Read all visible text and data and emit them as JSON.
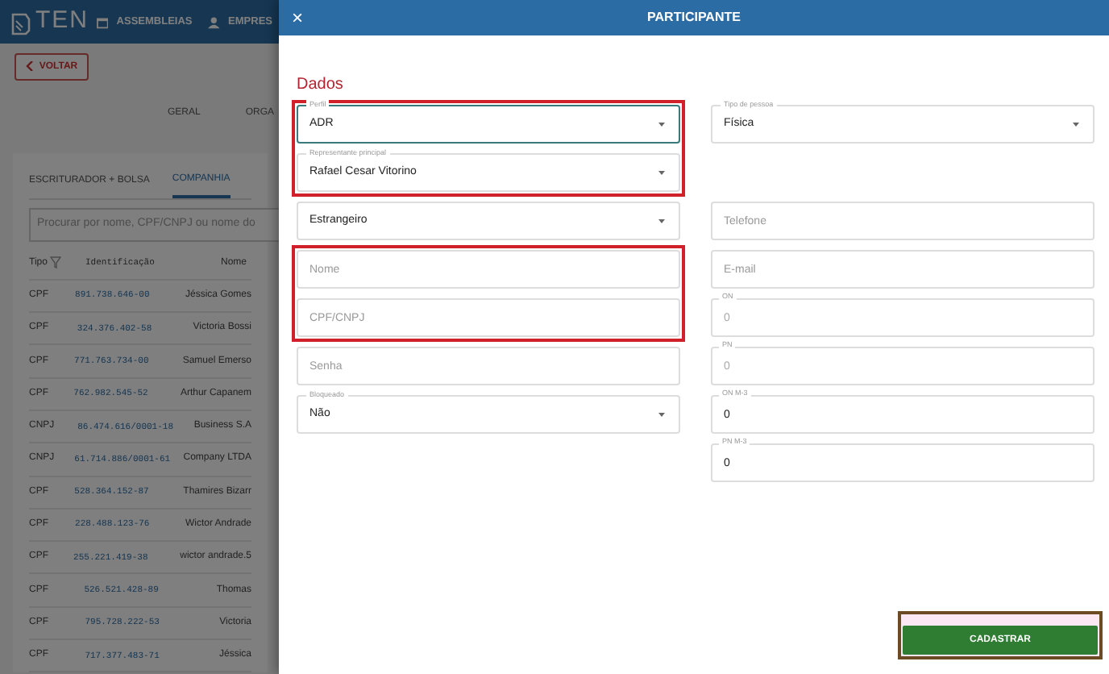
{
  "app": {
    "logo": "TEN",
    "nav": [
      {
        "label": "ASSEMBLEIAS"
      },
      {
        "label": "EMPRES"
      }
    ]
  },
  "back_button": "VOLTAR",
  "page_tabs": [
    {
      "label": "GERAL",
      "selected": false
    },
    {
      "label": "ORGA",
      "selected": false
    }
  ],
  "card_tabs": [
    {
      "label": "ESCRITURADOR + BOLSA",
      "selected": false
    },
    {
      "label": "COMPANHIA",
      "selected": true
    }
  ],
  "search": {
    "placeholder": "Procurar por nome, CPF/CNPJ ou nome do"
  },
  "table": {
    "columns": [
      "Tipo",
      "Identificação",
      "Nome"
    ],
    "rows": [
      [
        "CPF",
        "891.738.646-00",
        "Jéssica Gomes"
      ],
      [
        "CPF",
        "324.376.402-58",
        "Victoria Bossi"
      ],
      [
        "CPF",
        "771.763.734-00",
        "Samuel Emerso"
      ],
      [
        "CPF",
        "762.982.545-52",
        "Arthur Capanem"
      ],
      [
        "CNPJ",
        "86.474.616/0001-18",
        "Business S.A"
      ],
      [
        "CNPJ",
        "61.714.886/0001-61",
        "Company LTDA"
      ],
      [
        "CPF",
        "528.364.152-87",
        "Thamires Bizarr"
      ],
      [
        "CPF",
        "228.488.123-76",
        "Wictor Andrade"
      ],
      [
        "CPF",
        "255.221.419-38",
        "wictor andrade.5"
      ],
      [
        "CPF",
        "526.521.428-89",
        "Thomas"
      ],
      [
        "CPF",
        "795.728.222-53",
        "Victoria"
      ],
      [
        "CPF",
        "717.377.483-71",
        "Jéssica"
      ]
    ]
  },
  "drawer": {
    "close": "×",
    "title": "PARTICIPANTE",
    "section": "Dados",
    "left_groups": [
      {
        "highlighted": true,
        "fields": [
          {
            "kind": "select",
            "label": "Perfil",
            "value": "ADR",
            "focused": true
          },
          {
            "kind": "select",
            "label": "Representante principal",
            "value": "Rafael Cesar Vitorino",
            "focused": false
          }
        ]
      },
      {
        "highlighted": false,
        "fields": [
          {
            "kind": "select",
            "value": "Estrangeiro",
            "focused": false
          }
        ]
      },
      {
        "highlighted": true,
        "fields": [
          {
            "kind": "input",
            "placeholder": "Nome",
            "focused": false
          },
          {
            "kind": "input",
            "placeholder": "CPF/CNPJ",
            "focused": false
          }
        ]
      },
      {
        "highlighted": false,
        "fields": [
          {
            "kind": "input",
            "placeholder": "Senha",
            "focused": false
          },
          {
            "kind": "select",
            "label": "Bloqueado",
            "value": "Não",
            "focused": false
          }
        ]
      }
    ],
    "right_fields": [
      {
        "kind": "select",
        "label": "Tipo de pessoa",
        "value": "Física",
        "disabled": false
      },
      {
        "kind": "input",
        "placeholder": "Telefone"
      },
      {
        "kind": "input",
        "placeholder": "E-mail"
      },
      {
        "kind": "input",
        "label": "ON",
        "value": "0",
        "disabled": true
      },
      {
        "kind": "input",
        "label": "PN",
        "value": "0",
        "disabled": true
      },
      {
        "kind": "input",
        "label": "ON M-3",
        "value": "0",
        "disabled": false
      },
      {
        "kind": "input",
        "label": "PN M-3",
        "value": "0",
        "disabled": false
      }
    ],
    "submit": {
      "label": "CADASTRAR",
      "highlighted": true
    }
  }
}
